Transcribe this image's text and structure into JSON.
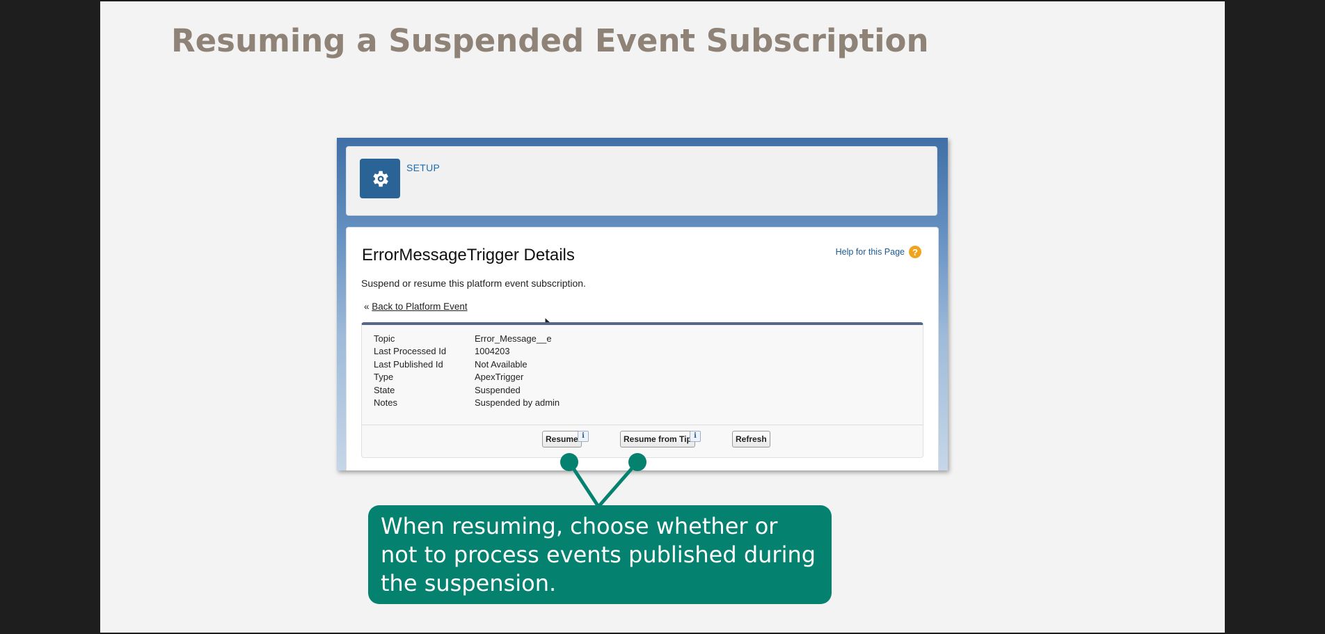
{
  "slide": {
    "title": "Resuming a Suspended Event Subscription"
  },
  "setup": {
    "label": "SETUP",
    "icon": "gear-icon",
    "brand_color": "#2a6496"
  },
  "details": {
    "heading": "ErrorMessageTrigger Details",
    "help_link": "Help for this Page",
    "help_icon": "question-icon",
    "description": "Suspend or resume this platform event subscription.",
    "back_prefix": "«",
    "back_link": "Back to Platform Event",
    "fields": [
      {
        "label": "Topic",
        "value": "Error_Message__e"
      },
      {
        "label": "Last Processed Id",
        "value": "1004203"
      },
      {
        "label": "Last Published Id",
        "value": "Not Available"
      },
      {
        "label": "Type",
        "value": "ApexTrigger"
      },
      {
        "label": "State",
        "value": "Suspended"
      },
      {
        "label": "Notes",
        "value": "Suspended by admin"
      }
    ],
    "buttons": {
      "resume": "Resume",
      "resume_from_tip": "Resume from Tip",
      "refresh": "Refresh"
    },
    "info_glyph": "i"
  },
  "callout": {
    "text": "When resuming, choose whether or not to process events published during the suspension.",
    "color": "#04826f"
  }
}
